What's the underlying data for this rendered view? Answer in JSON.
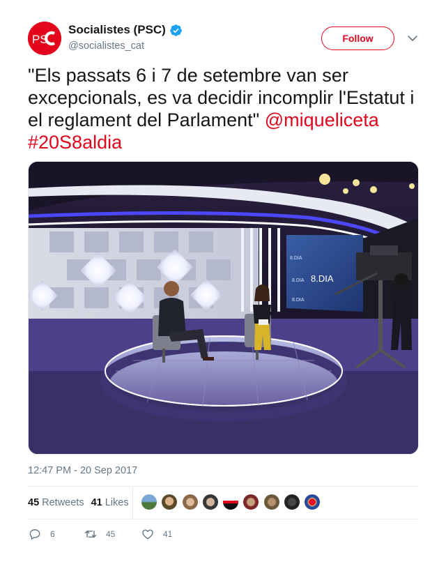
{
  "account": {
    "display_name": "Socialistes (PSC)",
    "handle": "@socialistes_cat",
    "avatar_text": "PSC",
    "verified": true
  },
  "header": {
    "follow_label": "Follow",
    "menu_icon": "chevron-down-icon"
  },
  "tweet": {
    "text_plain": "\"Els passats 6 i 7 de setembre van ser excepcionals, es va decidir incomplir l'Estatut i el reglament del Parlament\" ",
    "mention": "@miqueliceta",
    "hashtag": "#20S8aldia",
    "timestamp": "12:47 PM - 20 Sep 2017"
  },
  "media": {
    "studio_screen_text_1": "8.DIA",
    "studio_screen_text_2": "8.DIA",
    "studio_screen_text_3": "8.DIA",
    "studio_screen_text_4": "8.DIA"
  },
  "stats": {
    "retweets_count": "45",
    "retweets_label": "Retweets",
    "likes_count": "41",
    "likes_label": "Likes",
    "liker_avatar_count": 9
  },
  "actions": {
    "reply_count": "6",
    "retweet_count": "45",
    "like_count": "41"
  },
  "colors": {
    "brand_red": "#e3051b",
    "verified_blue": "#1da1f2",
    "muted_gray": "#657786"
  }
}
